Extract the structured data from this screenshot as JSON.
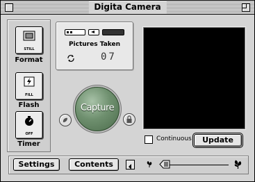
{
  "window": {
    "title": "Digita Camera"
  },
  "modes": [
    {
      "icon_text": "STILL",
      "label": "Format",
      "icon": "monitor-icon"
    },
    {
      "icon_text": "FILL",
      "label": "Flash",
      "icon": "flash-icon"
    },
    {
      "icon_text": "OFF",
      "label": "Timer",
      "icon": "stopwatch-icon"
    }
  ],
  "info": {
    "pictures_label": "Pictures Taken",
    "count": "07"
  },
  "capture": {
    "label": "Capture"
  },
  "options": {
    "continuous_label": "Continuous",
    "continuous_checked": false,
    "update_label": "Update"
  },
  "bottom": {
    "settings_label": "Settings",
    "contents_label": "Contents",
    "volume_level": 0.0
  },
  "colors": {
    "capture_green": "#6f906f",
    "preview_bg": "#000000"
  }
}
